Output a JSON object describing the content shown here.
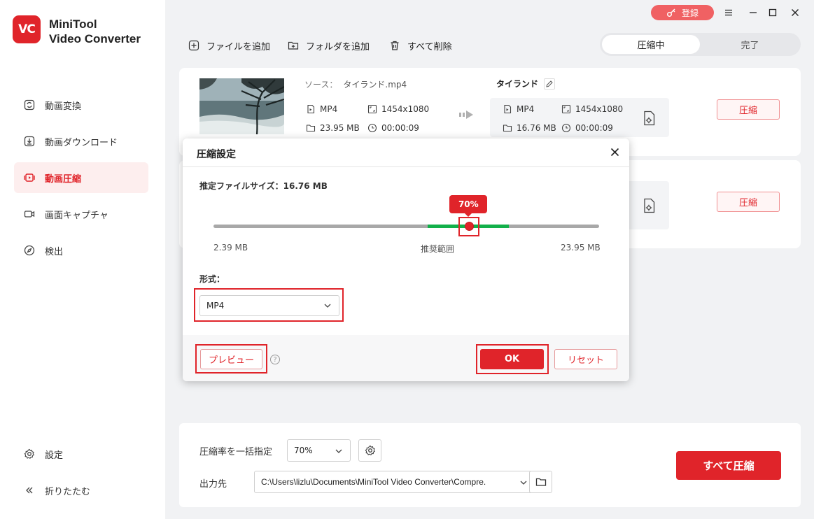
{
  "app": {
    "logo_text": "VC",
    "name_line1": "MiniTool",
    "name_line2": "Video Converter"
  },
  "sidebar": {
    "items": [
      {
        "label": "動画変換",
        "icon": "convert-icon"
      },
      {
        "label": "動画ダウンロード",
        "icon": "download-icon"
      },
      {
        "label": "動画圧縮",
        "icon": "compress-icon",
        "active": true
      },
      {
        "label": "画面キャプチャ",
        "icon": "camera-icon"
      },
      {
        "label": "検出",
        "icon": "compass-icon"
      }
    ],
    "settings_label": "設定",
    "collapse_label": "折りたたむ"
  },
  "titlebar": {
    "register_label": "登録"
  },
  "toolbar": {
    "add_file": "ファイルを追加",
    "add_folder": "フォルダを追加",
    "delete_all": "すべて削除"
  },
  "tabs": {
    "compressing": "圧縮中",
    "done": "完了"
  },
  "file1": {
    "source_label": "ソース：",
    "source_name": "タイランド.mp4",
    "format": "MP4",
    "resolution": "1454x1080",
    "size": "23.95 MB",
    "duration": "00:00:09",
    "target_name": "タイランド",
    "target_format": "MP4",
    "target_resolution": "1454x1080",
    "target_size": "16.76 MB",
    "target_duration": "00:00:09",
    "compress_label": "圧縮"
  },
  "file2": {
    "compress_label": "圧縮"
  },
  "dialog": {
    "title": "圧縮設定",
    "estimated_label": "推定ファイルサイズ：16.76 MB",
    "slider_value": 0.7,
    "slider_tooltip": "70%",
    "min_label": "2.39 MB",
    "recommended_label": "推奨範囲",
    "max_label": "23.95 MB",
    "format_label": "形式：",
    "format_value": "MP4",
    "preview_label": "プレビュー",
    "ok_label": "OK",
    "reset_label": "リセット"
  },
  "bottom": {
    "ratio_label": "圧縮率を一括指定",
    "ratio_value": "70%",
    "output_label": "出力先",
    "output_path": "C:\\Users\\lizlu\\Documents\\MiniTool Video Converter\\Compre.",
    "compress_all_label": "すべて圧縮"
  },
  "colors": {
    "accent": "#e0242a",
    "recommended": "#12b04a"
  }
}
